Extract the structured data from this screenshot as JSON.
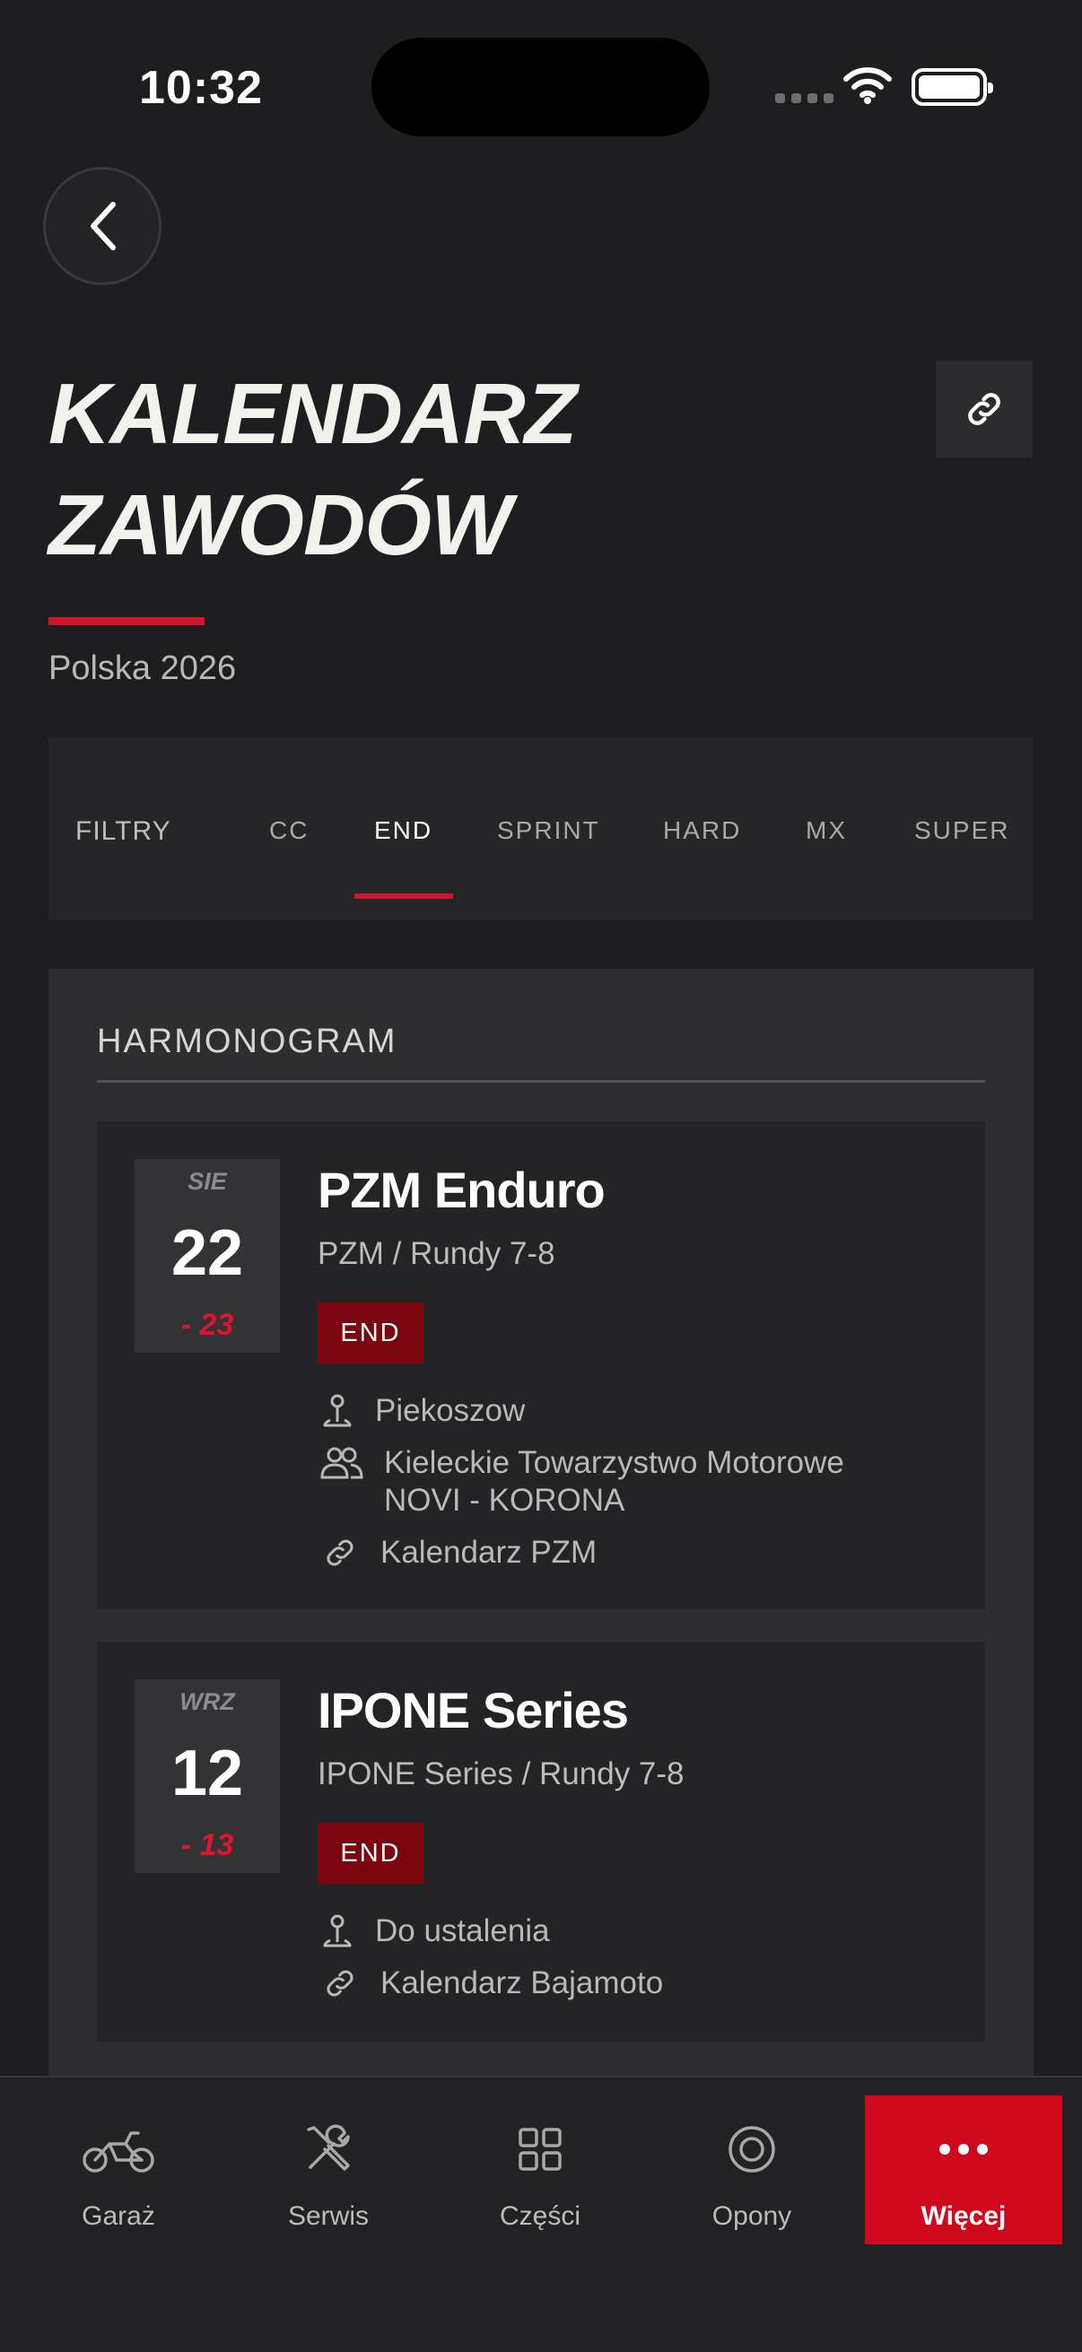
{
  "status_bar": {
    "time": "10:32"
  },
  "header": {
    "title_line1": "KALENDARZ",
    "title_line2": "ZAWODÓW",
    "subtitle": "Polska 2026"
  },
  "filters": {
    "label": "FILTRY",
    "tabs": [
      "CC",
      "END",
      "SPRINT",
      "HARD",
      "MX",
      "SUPER"
    ],
    "active_tab": "END"
  },
  "schedule": {
    "title": "HARMONOGRAM",
    "events": [
      {
        "month": "SIE",
        "day": "22",
        "end": "- 23",
        "title": "PZM Enduro",
        "subtitle": "PZM / Rundy 7-8",
        "badge": "END",
        "location": "Piekoszow",
        "organizer_line1": "Kieleckie Towarzystwo Motorowe",
        "organizer_line2": "NOVI - KORONA",
        "link": "Kalendarz PZM"
      },
      {
        "month": "WRZ",
        "day": "12",
        "end": "- 13",
        "title": "IPONE Series",
        "subtitle": "IPONE Series / Rundy 7-8",
        "badge": "END",
        "location": "Do ustalenia",
        "link": "Kalendarz Bajamoto"
      }
    ]
  },
  "bottom_nav": {
    "items": [
      {
        "label": "Garaż",
        "icon": "motorcycle-icon"
      },
      {
        "label": "Serwis",
        "icon": "wrench-screwdriver-icon"
      },
      {
        "label": "Części",
        "icon": "grid-icon"
      },
      {
        "label": "Opony",
        "icon": "tire-icon"
      },
      {
        "label": "Więcej",
        "icon": "more-dots-icon"
      }
    ],
    "active": "Więcej"
  },
  "colors": {
    "background": "#1e1e20",
    "accent_red": "#d0142c",
    "badge_red": "#7c0610",
    "nav_active": "#d0081c"
  }
}
